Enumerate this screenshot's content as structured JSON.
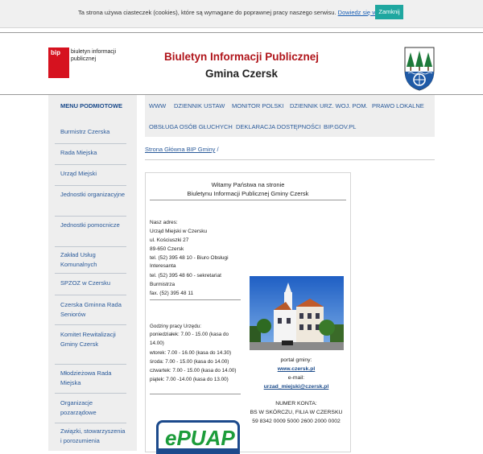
{
  "cookie": {
    "text": "Ta strona używa ciasteczek (cookies), które są wymagane do poprawnej pracy naszego serwisu.",
    "link": "Dowiedz się więcej",
    "button": "Zamknij"
  },
  "header": {
    "bip_logo_label": "biuletyn informacji publicznej",
    "bip_mark": "bip",
    "title": "Biuletyn Informacji Publicznej",
    "subtitle": "Gmina Czersk"
  },
  "sidebar": {
    "heading": "MENU PODMIOTOWE",
    "items": [
      "Burmistrz Czerska",
      "Rada Miejska",
      "Urząd Miejski",
      "Jednostki organizacyjne",
      "Jednostki pomocnicze",
      "Zakład Usług Komunalnych",
      "SPZOZ w Czersku",
      "Czerska Gminna Rada Seniorów",
      "Komitet Rewitalizacji Gminy Czersk",
      "Młodzieżowa Rada Miejska",
      "Organizacje pozarządowe",
      "Związki, stowarzyszenia i porozumienia"
    ]
  },
  "topnav": {
    "items": [
      "WWW",
      "DZIENNIK USTAW",
      "MONITOR POLSKI",
      "DZIENNIK URZ. WOJ. POM.",
      "PRAWO LOKALNE",
      "OBSŁUGA OSÓB GŁUCHYCH",
      "DEKLARACJA DOSTĘPNOŚCI",
      "BIP.GOV.PL"
    ]
  },
  "breadcrumb": {
    "home": "Strona Główna BIP Gminy",
    "separator": "/"
  },
  "content": {
    "welcome_line1": "Witamy Państwa na stronie",
    "welcome_line2": "Biuletynu Informacji Publicznej Gminy Czersk",
    "address_lines": [
      "Nasz adres:",
      "Urząd Miejski w Czersku",
      "ul. Kościuszki 27",
      "89-650 Czersk",
      "tel. (52) 395 48 10 -  Biuro Obsługi",
      "                              Interesanta",
      "tel. (52) 395 48 60 -  sekretariat",
      "                              Burmistrza",
      "fax. (52) 395 48 11"
    ],
    "hours_lines": [
      "Godziny pracy Urzędu:",
      "poniedziałek: 7.00 - 15.00 (kasa do",
      "14.00)",
      "wtorek: 7.00 - 16.00 (kasa do 14.30)",
      "środa: 7.00 - 15.00 (kasa do 14.00)",
      "czwartek: 7.00 - 15.00 (kasa do 14.00)",
      "piątek: 7.00 -14.00 (kasa do 13.00)"
    ],
    "portal_label": "portal gminy:",
    "portal_link": "www.czersk.pl",
    "email_label": "e-mail:",
    "email_link": "urzad_miejski@czersk.pl",
    "account_heading": "NUMER KONTA:",
    "account_bank": "BS W SKÓRCZU, FILIA W CZERSKU",
    "account_number": "59 8342 0009 5000 2600 2000 0002",
    "epuap_label": "ePUAP"
  },
  "colors": {
    "bip_red": "#d6121f",
    "title_red": "#b0151b",
    "link_blue": "#2a5a9a",
    "cookie_button": "#1fa7a0",
    "sidebar_bg": "#eeeeee"
  }
}
